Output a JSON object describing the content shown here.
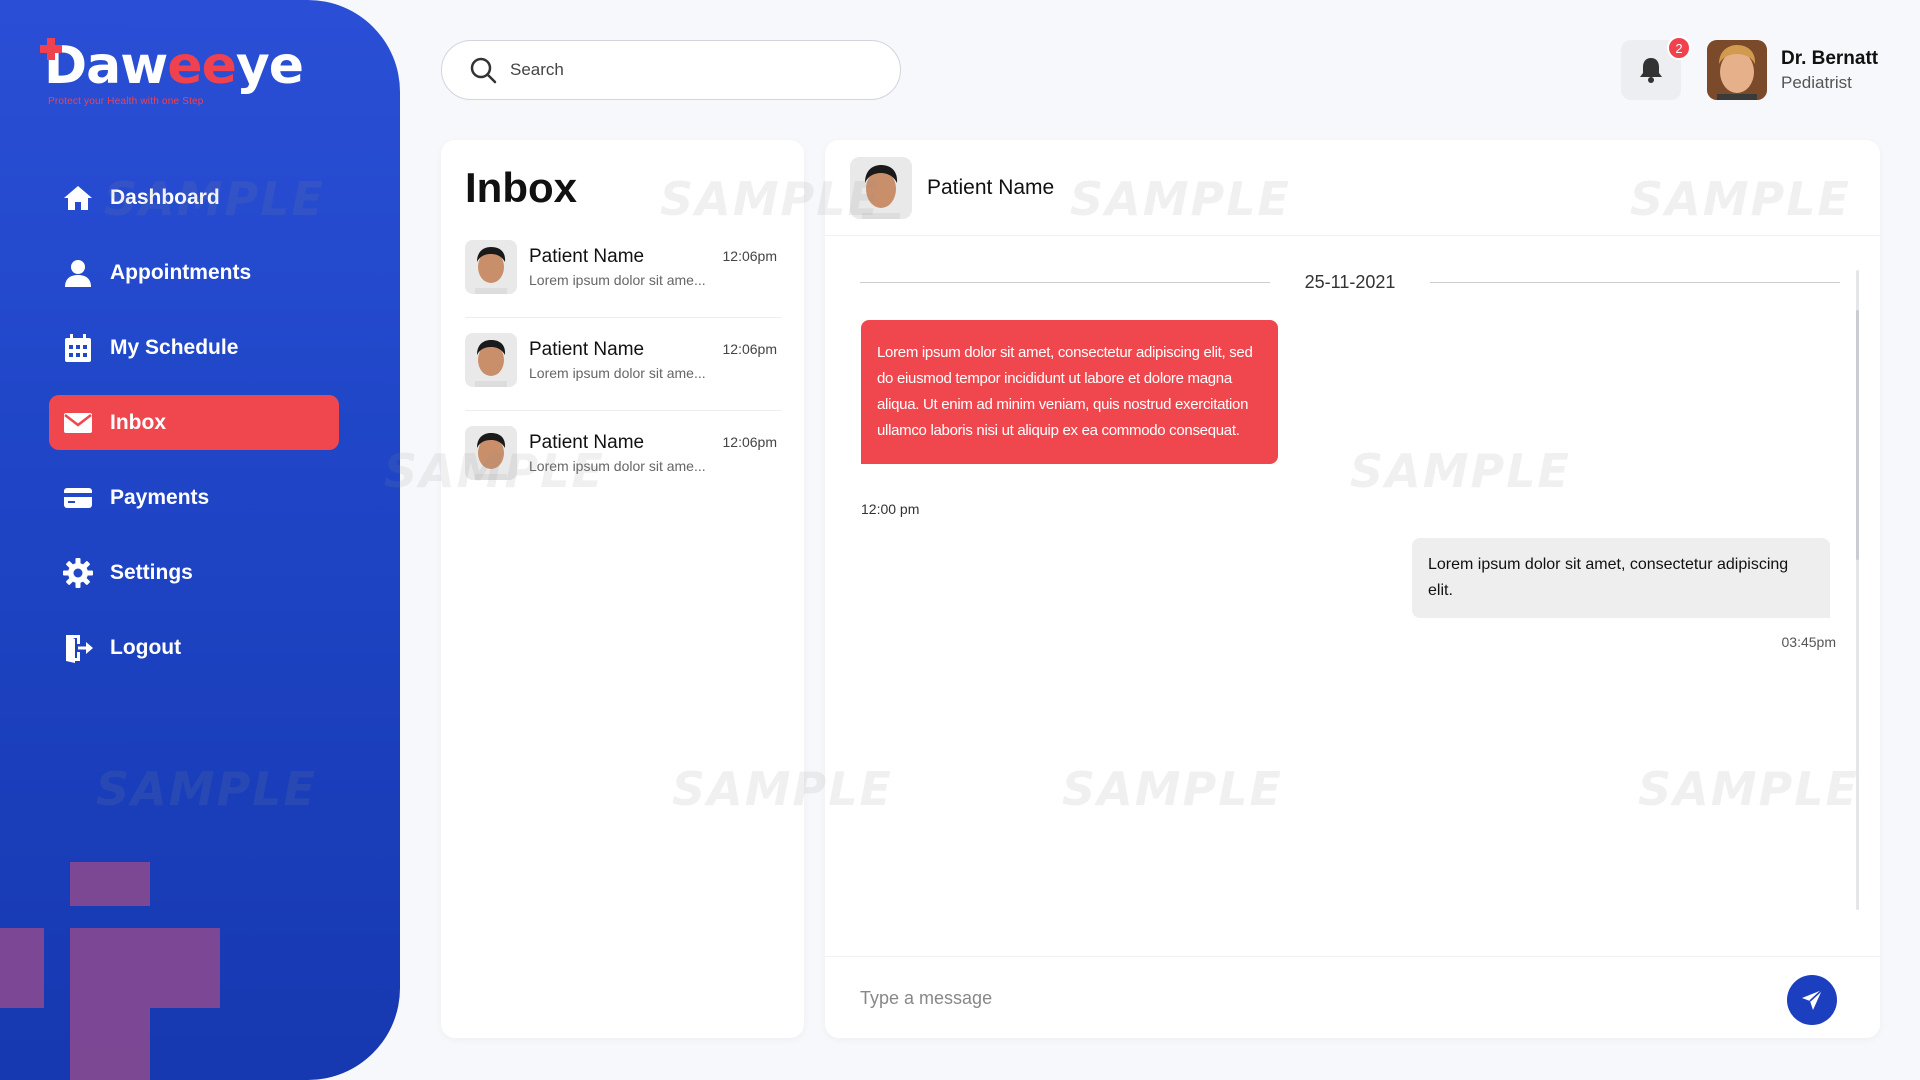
{
  "brand": {
    "logo_main": "Daw",
    "logo_accent": "ee",
    "logo_end": "ye",
    "tagline": "Protect your Health with one Step"
  },
  "sidebar": {
    "items": [
      {
        "label": "Dashboard",
        "icon": "home-icon",
        "active": false
      },
      {
        "label": "Appointments",
        "icon": "user-icon",
        "active": false
      },
      {
        "label": "My Schedule",
        "icon": "calendar-icon",
        "active": false
      },
      {
        "label": "Inbox",
        "icon": "mail-icon",
        "active": true
      },
      {
        "label": "Payments",
        "icon": "card-icon",
        "active": false
      },
      {
        "label": "Settings",
        "icon": "gear-icon",
        "active": false
      },
      {
        "label": "Logout",
        "icon": "logout-icon",
        "active": false
      }
    ]
  },
  "search": {
    "placeholder": "Search"
  },
  "notifications": {
    "count": "2"
  },
  "profile": {
    "name": "Dr. Bernatt",
    "role": "Pediatrist"
  },
  "inbox": {
    "title": "Inbox",
    "conversations": [
      {
        "name": "Patient Name",
        "time": "12:06pm",
        "preview": "Lorem ipsum dolor sit ame..."
      },
      {
        "name": "Patient Name",
        "time": "12:06pm",
        "preview": "Lorem ipsum dolor sit ame..."
      },
      {
        "name": "Patient Name",
        "time": "12:06pm",
        "preview": "Lorem ipsum dolor sit ame..."
      }
    ]
  },
  "chat": {
    "patient_name": "Patient Name",
    "date": "25-11-2021",
    "messages": [
      {
        "direction": "incoming",
        "text": "Lorem ipsum dolor sit amet, consectetur adipiscing elit, sed do eiusmod tempor incididunt ut labore et dolore magna aliqua. Ut enim ad minim veniam, quis nostrud exercitation ullamco laboris nisi ut aliquip ex ea commodo consequat.",
        "time": "12:00 pm"
      },
      {
        "direction": "outgoing",
        "text": "Lorem ipsum dolor sit amet, consectetur adipiscing elit.",
        "time": "03:45pm"
      }
    ],
    "composer_placeholder": "Type a message"
  },
  "watermark": "SAMPLE",
  "colors": {
    "sidebar_blue": "#1f45c6",
    "accent_red": "#f0474f",
    "send_button": "#1c3fc0"
  }
}
